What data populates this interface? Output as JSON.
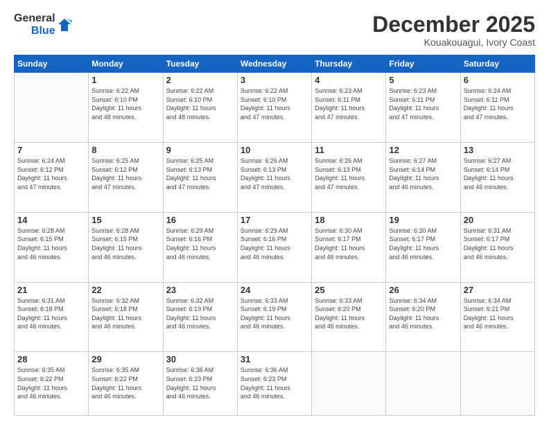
{
  "header": {
    "logo_general": "General",
    "logo_blue": "Blue",
    "month": "December 2025",
    "location": "Kouakouagui, Ivory Coast"
  },
  "weekdays": [
    "Sunday",
    "Monday",
    "Tuesday",
    "Wednesday",
    "Thursday",
    "Friday",
    "Saturday"
  ],
  "weeks": [
    [
      {
        "day": "",
        "info": ""
      },
      {
        "day": "1",
        "info": "Sunrise: 6:22 AM\nSunset: 6:10 PM\nDaylight: 11 hours\nand 48 minutes."
      },
      {
        "day": "2",
        "info": "Sunrise: 6:22 AM\nSunset: 6:10 PM\nDaylight: 11 hours\nand 48 minutes."
      },
      {
        "day": "3",
        "info": "Sunrise: 6:22 AM\nSunset: 6:10 PM\nDaylight: 11 hours\nand 47 minutes."
      },
      {
        "day": "4",
        "info": "Sunrise: 6:23 AM\nSunset: 6:11 PM\nDaylight: 11 hours\nand 47 minutes."
      },
      {
        "day": "5",
        "info": "Sunrise: 6:23 AM\nSunset: 6:11 PM\nDaylight: 11 hours\nand 47 minutes."
      },
      {
        "day": "6",
        "info": "Sunrise: 6:24 AM\nSunset: 6:11 PM\nDaylight: 11 hours\nand 47 minutes."
      }
    ],
    [
      {
        "day": "7",
        "info": "Sunrise: 6:24 AM\nSunset: 6:12 PM\nDaylight: 11 hours\nand 47 minutes."
      },
      {
        "day": "8",
        "info": "Sunrise: 6:25 AM\nSunset: 6:12 PM\nDaylight: 11 hours\nand 47 minutes."
      },
      {
        "day": "9",
        "info": "Sunrise: 6:25 AM\nSunset: 6:13 PM\nDaylight: 11 hours\nand 47 minutes."
      },
      {
        "day": "10",
        "info": "Sunrise: 6:26 AM\nSunset: 6:13 PM\nDaylight: 11 hours\nand 47 minutes."
      },
      {
        "day": "11",
        "info": "Sunrise: 6:26 AM\nSunset: 6:13 PM\nDaylight: 11 hours\nand 47 minutes."
      },
      {
        "day": "12",
        "info": "Sunrise: 6:27 AM\nSunset: 6:14 PM\nDaylight: 11 hours\nand 46 minutes."
      },
      {
        "day": "13",
        "info": "Sunrise: 6:27 AM\nSunset: 6:14 PM\nDaylight: 11 hours\nand 46 minutes."
      }
    ],
    [
      {
        "day": "14",
        "info": "Sunrise: 6:28 AM\nSunset: 6:15 PM\nDaylight: 11 hours\nand 46 minutes."
      },
      {
        "day": "15",
        "info": "Sunrise: 6:28 AM\nSunset: 6:15 PM\nDaylight: 11 hours\nand 46 minutes."
      },
      {
        "day": "16",
        "info": "Sunrise: 6:29 AM\nSunset: 6:16 PM\nDaylight: 11 hours\nand 46 minutes."
      },
      {
        "day": "17",
        "info": "Sunrise: 6:29 AM\nSunset: 6:16 PM\nDaylight: 11 hours\nand 46 minutes."
      },
      {
        "day": "18",
        "info": "Sunrise: 6:30 AM\nSunset: 6:17 PM\nDaylight: 11 hours\nand 46 minutes."
      },
      {
        "day": "19",
        "info": "Sunrise: 6:30 AM\nSunset: 6:17 PM\nDaylight: 11 hours\nand 46 minutes."
      },
      {
        "day": "20",
        "info": "Sunrise: 6:31 AM\nSunset: 6:17 PM\nDaylight: 11 hours\nand 46 minutes."
      }
    ],
    [
      {
        "day": "21",
        "info": "Sunrise: 6:31 AM\nSunset: 6:18 PM\nDaylight: 11 hours\nand 46 minutes."
      },
      {
        "day": "22",
        "info": "Sunrise: 6:32 AM\nSunset: 6:18 PM\nDaylight: 11 hours\nand 46 minutes."
      },
      {
        "day": "23",
        "info": "Sunrise: 6:32 AM\nSunset: 6:19 PM\nDaylight: 11 hours\nand 46 minutes."
      },
      {
        "day": "24",
        "info": "Sunrise: 6:33 AM\nSunset: 6:19 PM\nDaylight: 11 hours\nand 46 minutes."
      },
      {
        "day": "25",
        "info": "Sunrise: 6:33 AM\nSunset: 6:20 PM\nDaylight: 11 hours\nand 46 minutes."
      },
      {
        "day": "26",
        "info": "Sunrise: 6:34 AM\nSunset: 6:20 PM\nDaylight: 11 hours\nand 46 minutes."
      },
      {
        "day": "27",
        "info": "Sunrise: 6:34 AM\nSunset: 6:21 PM\nDaylight: 11 hours\nand 46 minutes."
      }
    ],
    [
      {
        "day": "28",
        "info": "Sunrise: 6:35 AM\nSunset: 6:22 PM\nDaylight: 11 hours\nand 46 minutes."
      },
      {
        "day": "29",
        "info": "Sunrise: 6:35 AM\nSunset: 6:22 PM\nDaylight: 11 hours\nand 46 minutes."
      },
      {
        "day": "30",
        "info": "Sunrise: 6:36 AM\nSunset: 6:23 PM\nDaylight: 11 hours\nand 46 minutes."
      },
      {
        "day": "31",
        "info": "Sunrise: 6:36 AM\nSunset: 6:23 PM\nDaylight: 11 hours\nand 46 minutes."
      },
      {
        "day": "",
        "info": ""
      },
      {
        "day": "",
        "info": ""
      },
      {
        "day": "",
        "info": ""
      }
    ]
  ]
}
